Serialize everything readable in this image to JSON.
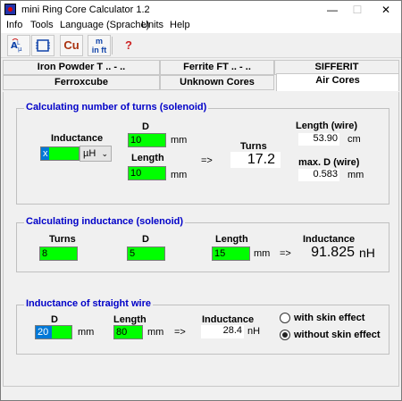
{
  "window": {
    "title": "mini Ring Core Calculator 1.2",
    "min_glyph": "—",
    "max_glyph": "☐",
    "close_glyph": "✕"
  },
  "menu": {
    "info": "Info",
    "tools": "Tools",
    "language": "Language (Sprache)",
    "units": "Units",
    "help": "Help"
  },
  "toolbar": {
    "icons": [
      "resistor-formula-icon",
      "core-icon",
      "copper-wire-icon",
      "unit-conversion-icon",
      "help-icon"
    ],
    "cu_label": "Cu",
    "unit_label_top": "m",
    "unit_label_bottom": "in ft",
    "help_label": "?"
  },
  "tabs": {
    "row1": [
      "Iron Powder T .. - ..",
      "Ferrite FT .. - ..",
      "SIFFERIT"
    ],
    "row2": [
      "Ferroxcube",
      "Unknown Cores",
      "Air Cores"
    ],
    "active": "Air Cores"
  },
  "turns_group": {
    "title": "Calculating number of turns (solenoid)",
    "inductance_label": "Inductance",
    "inductance_value": "x",
    "inductance_unit": "µH",
    "d_label": "D",
    "d_value": "10",
    "d_unit": "mm",
    "length_label": "Length",
    "length_value": "10",
    "length_unit": "mm",
    "arrow": "=>",
    "turns_label": "Turns",
    "turns_value": "17.2",
    "wire_length_label": "Length (wire)",
    "wire_length_value": "53.90",
    "wire_length_unit": "cm",
    "max_d_label": "max. D (wire)",
    "max_d_value": "0.583",
    "max_d_unit": "mm"
  },
  "inductance_group": {
    "title": "Calculating inductance (solenoid)",
    "turns_label": "Turns",
    "turns_value": "8",
    "d_label": "D",
    "d_value": "5",
    "length_label": "Length",
    "length_value": "15",
    "length_unit": "mm",
    "arrow": "=>",
    "inductance_label": "Inductance",
    "inductance_value": "91.825",
    "inductance_unit": "nH"
  },
  "wire_group": {
    "title": "Inductance of straight wire",
    "d_label": "D",
    "d_value": "20",
    "d_unit": "mm",
    "length_label": "Length",
    "length_value": "80",
    "length_unit": "mm",
    "arrow": "=>",
    "inductance_label": "Inductance",
    "inductance_value": "28.4",
    "inductance_unit": "nH",
    "radio_with": "with skin effect",
    "radio_without": "without skin effect",
    "selected": "without skin effect"
  }
}
